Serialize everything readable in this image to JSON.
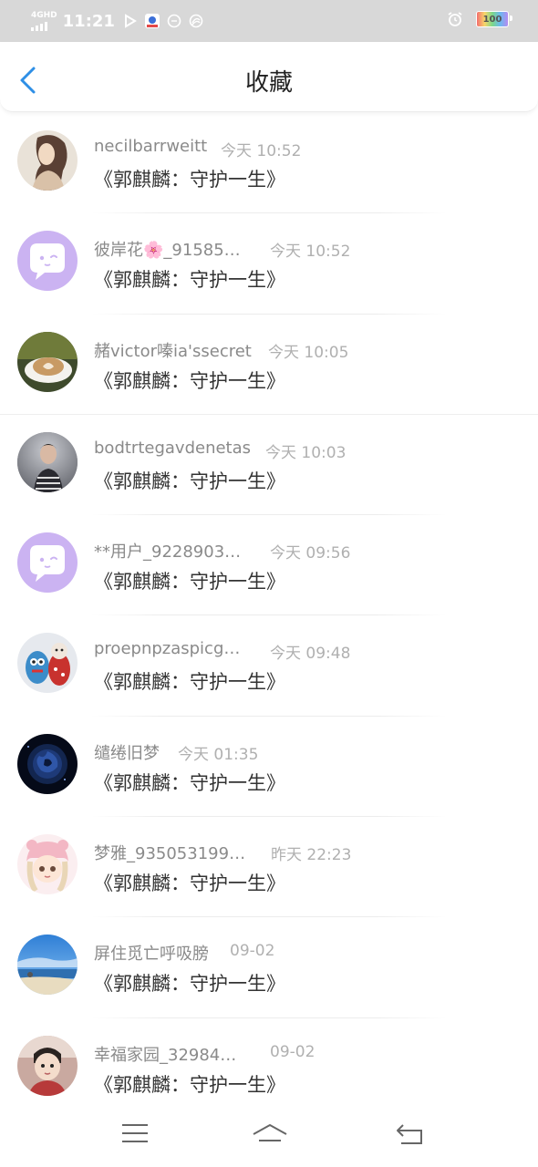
{
  "status_bar": {
    "network": "4GHD",
    "time": "11:21",
    "battery": "100",
    "icons": [
      "play-icon",
      "app-notification-icon",
      "circle-icon",
      "sync-icon",
      "alarm-icon"
    ]
  },
  "header": {
    "title": "收藏",
    "back_icon": "chevron-left-icon",
    "accent": "#2e8fe6"
  },
  "items": [
    {
      "name": "necilbarrweitt",
      "time": "今天 10:52",
      "title": "《郭麒麟：守护一生》",
      "avatar": "portrait-sketch"
    },
    {
      "name": "彼岸花🌸_91585…",
      "time": "今天 10:52",
      "title": "《郭麒麟：守护一生》",
      "avatar": "default-chat-avatar"
    },
    {
      "name": "赭victor嗪ia'ssecret",
      "time": "今天 10:05",
      "title": "《郭麒麟：守护一生》",
      "avatar": "latte-cup"
    },
    {
      "name": "bodtrtegavdenetas",
      "time": "今天 10:03",
      "title": "《郭麒麟：守护一生》",
      "avatar": "person-photo"
    },
    {
      "name": "**用户_9228903…",
      "time": "今天 09:56",
      "title": "《郭麒麟：守护一生》",
      "avatar": "default-chat-avatar"
    },
    {
      "name": "proepnpzaspicg…",
      "time": "今天 09:48",
      "title": "《郭麒麟：守护一生》",
      "avatar": "knit-dolls"
    },
    {
      "name": "缱绻旧梦",
      "time": "今天 01:35",
      "title": "《郭麒麟：守护一生》",
      "avatar": "blue-rose"
    },
    {
      "name": "梦雅_935053199…",
      "time": "昨天 22:23",
      "title": "《郭麒麟：守护一生》",
      "avatar": "anime-girl"
    },
    {
      "name": "屏住觅亡呼吸膀",
      "time": "09-02",
      "title": "《郭麒麟：守护一生》",
      "avatar": "beach-sky"
    },
    {
      "name": "幸福家园_32984…",
      "time": "09-02",
      "title": "《郭麒麟：守护一生》",
      "avatar": "child-photo"
    }
  ],
  "nav_bar": {
    "menu_icon": "menu-icon",
    "home_icon": "home-icon",
    "back_icon": "back-arrow-icon"
  }
}
